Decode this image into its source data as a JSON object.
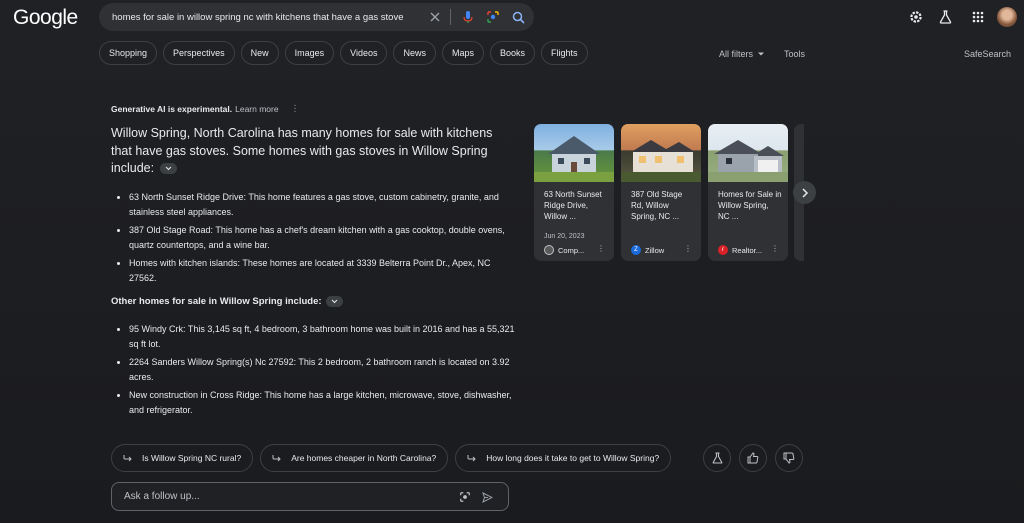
{
  "logo": "Google",
  "search": {
    "query": "homes for sale in willow spring nc with kitchens that have a gas stove"
  },
  "tabs": [
    "Shopping",
    "Perspectives",
    "New",
    "Images",
    "Videos",
    "News",
    "Maps",
    "Books",
    "Flights"
  ],
  "filters": {
    "all_filters": "All filters",
    "tools": "Tools",
    "safesearch": "SafeSearch"
  },
  "ai": {
    "disclaimer": "Generative AI is experimental.",
    "learn_more": "Learn more",
    "summary": "Willow Spring, North Carolina has many homes for sale with kitchens that have gas stoves. Some homes with gas stoves in Willow Spring include:",
    "items": [
      "63 North Sunset Ridge Drive: This home features a gas stove, custom cabinetry, granite, and stainless steel appliances.",
      "387 Old Stage Road: This home has a chef's dream kitchen with a gas cooktop, double ovens, quartz countertops, and a wine bar.",
      "Homes with kitchen islands: These homes are located at 3339 Belterra Point Dr., Apex, NC 27562."
    ],
    "subheading": "Other homes for sale in Willow Spring include:",
    "items2": [
      "95 Windy Crk: This 3,145 sq ft, 4 bedroom, 3 bathroom home was built in 2016 and has a 55,321 sq ft lot.",
      "2264 Sanders Willow Spring(s) Nc 27592: This 2 bedroom, 2 bathroom ranch is located on 3.92 acres.",
      "New construction in Cross Ridge: This home has a large kitchen, microwave, stove, dishwasher, and refrigerator."
    ]
  },
  "cards": [
    {
      "title": "63 North Sunset Ridge Drive, Willow ...",
      "date": "Jun 20, 2023",
      "source": "Comp...",
      "color": "#5a5a5a"
    },
    {
      "title": "387 Old Stage Rd, Willow Spring, NC ...",
      "date": "",
      "source": "Zillow",
      "color": "#1a6ad9"
    },
    {
      "title": "Homes for Sale in Willow Spring, NC ...",
      "date": "",
      "source": "Realtor...",
      "color": "#d92228"
    }
  ],
  "followups": [
    "Is Willow Spring NC rural?",
    "Are homes cheaper in North Carolina?",
    "How long does it take to get to Willow Spring?"
  ],
  "followup_input": {
    "placeholder": "Ask a follow up..."
  }
}
